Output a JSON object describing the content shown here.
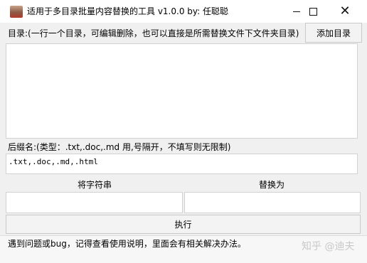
{
  "window": {
    "title": "适用于多目录批量内容替换的工具 v1.0.0    by: 任聪聪"
  },
  "directory": {
    "label": "目录:(一行一个目录，可编辑删除，也可以直接是所需替换文件下文件夹目录)",
    "add_button": "添加目录",
    "value": ""
  },
  "suffix": {
    "label": "后缀名:(类型：.txt,.doc,.md 用,号隔开，不填写则无限制)",
    "value": ".txt,.doc,.md,.html"
  },
  "replace": {
    "find_header": "将字符串",
    "replace_header": "替换为",
    "find_value": "",
    "replace_value": ""
  },
  "execute_button": "执行",
  "status": "遇到问题或bug，记得查看使用说明，里面会有相关解决办法。",
  "watermark": "知乎 @迪夫"
}
